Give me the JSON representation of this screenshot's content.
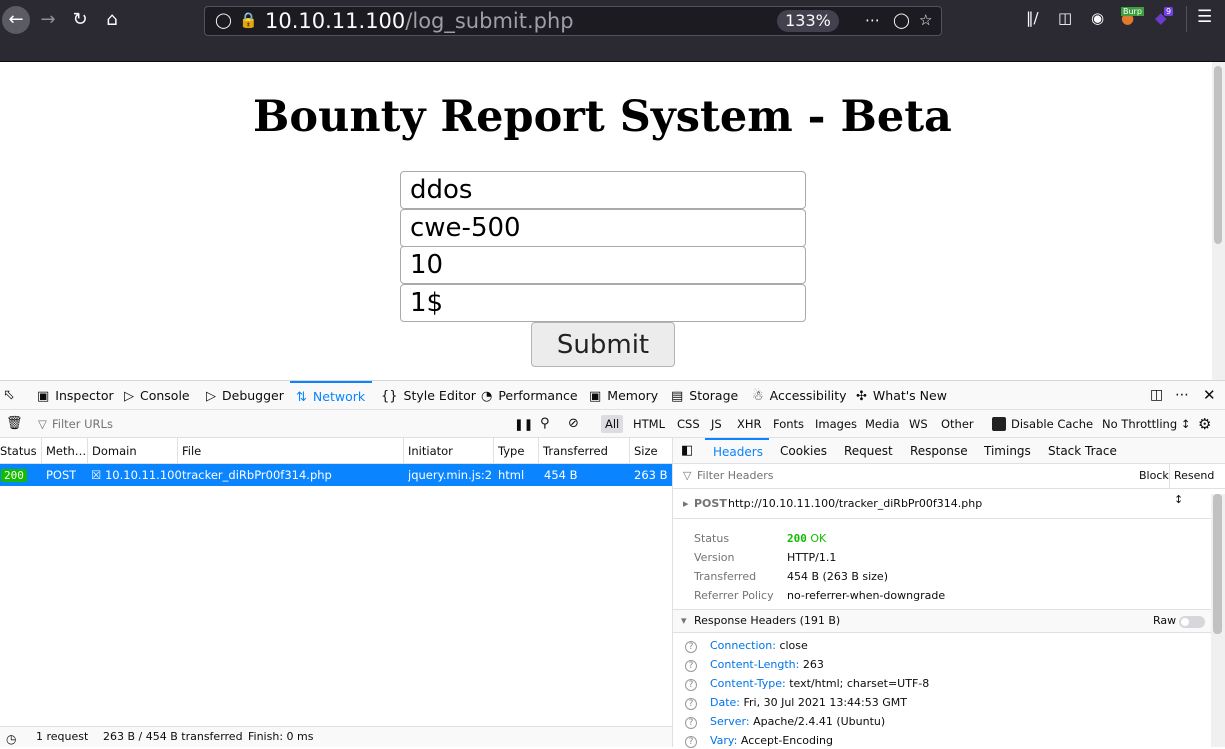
{
  "browser": {
    "url_host": "10.10.11.100",
    "url_path": "/log_submit.php",
    "zoom": "133%",
    "burp_badge": "Burp",
    "ext_count": "9"
  },
  "page": {
    "title": "Bounty Report System - Beta",
    "fields": [
      "ddos",
      "cwe-500",
      "10",
      "1$"
    ],
    "submit_label": "Submit"
  },
  "devtools": {
    "tabs": [
      "Inspector",
      "Console",
      "Debugger",
      "Network",
      "Style Editor",
      "Performance",
      "Memory",
      "Storage",
      "Accessibility",
      "What's New"
    ],
    "filter_placeholder": "Filter URLs",
    "type_filters": [
      "All",
      "HTML",
      "CSS",
      "JS",
      "XHR",
      "Fonts",
      "Images",
      "Media",
      "WS",
      "Other"
    ],
    "disable_cache": "Disable Cache",
    "throttling": "No Throttling ↕",
    "columns": [
      "Status",
      "Meth…",
      "Domain",
      "File",
      "Initiator",
      "Type",
      "Transferred",
      "Size"
    ],
    "request": {
      "status": "200",
      "method": "POST",
      "domain": "10.10.11.100",
      "file": "tracker_diRbPr00f314.php",
      "initiator": "jquery.min.js:2…",
      "type": "html",
      "transferred": "454 B",
      "size": "263 B"
    },
    "status_bar": {
      "requests": "1 request",
      "transferred": "263 B / 454 B transferred",
      "finish": "Finish: 0 ms"
    },
    "details": {
      "tabs": [
        "Headers",
        "Cookies",
        "Request",
        "Response",
        "Timings",
        "Stack Trace"
      ],
      "filter_placeholder": "Filter Headers",
      "block_label": "Block",
      "resend_label": "Resend ↕",
      "summary_method": "POST",
      "summary_url": "http://10.10.11.100/tracker_diRbPr00f314.php",
      "status_label": "Status",
      "status_code": "200",
      "status_text": "OK",
      "version_label": "Version",
      "version": "HTTP/1.1",
      "transferred_label": "Transferred",
      "transferred": "454 B (263 B size)",
      "referrer_label": "Referrer Policy",
      "referrer": "no-referrer-when-downgrade",
      "response_headers_label": "Response Headers (191 B)",
      "raw_label": "Raw",
      "headers": [
        {
          "name": "Connection:",
          "value": "close"
        },
        {
          "name": "Content-Length:",
          "value": "263"
        },
        {
          "name": "Content-Type:",
          "value": "text/html; charset=UTF-8"
        },
        {
          "name": "Date:",
          "value": "Fri, 30 Jul 2021 13:44:53 GMT"
        },
        {
          "name": "Server:",
          "value": "Apache/2.4.41 (Ubuntu)"
        },
        {
          "name": "Vary:",
          "value": "Accept-Encoding"
        }
      ]
    }
  }
}
